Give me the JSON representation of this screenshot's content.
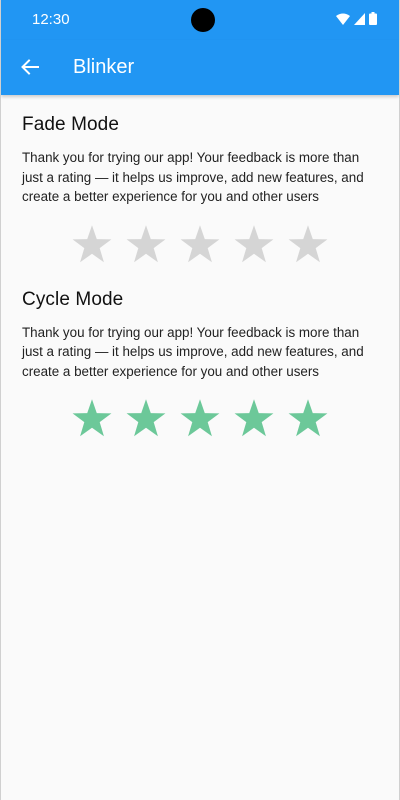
{
  "status_bar": {
    "time": "12:30"
  },
  "app_bar": {
    "title": "Blinker"
  },
  "sections": [
    {
      "title": "Fade Mode",
      "description": "Thank you for trying our app! Your feedback is more than just a rating — it helps us improve, add new features, and create a better experience for you and other users",
      "rating": 0,
      "max_rating": 5,
      "star_color": "#d5d5d5"
    },
    {
      "title": "Cycle Mode",
      "description": "Thank you for trying our app! Your feedback is more than just a rating — it helps us improve, add new features, and create a better experience for you and other users",
      "rating": 5,
      "max_rating": 5,
      "star_color": "#6cc899"
    }
  ],
  "colors": {
    "primary": "#2196f3",
    "star_empty": "#d5d5d5",
    "star_filled": "#6cc899"
  },
  "icons": [
    "back-arrow-icon",
    "wifi-icon",
    "signal-icon",
    "battery-icon",
    "star-icon"
  ]
}
